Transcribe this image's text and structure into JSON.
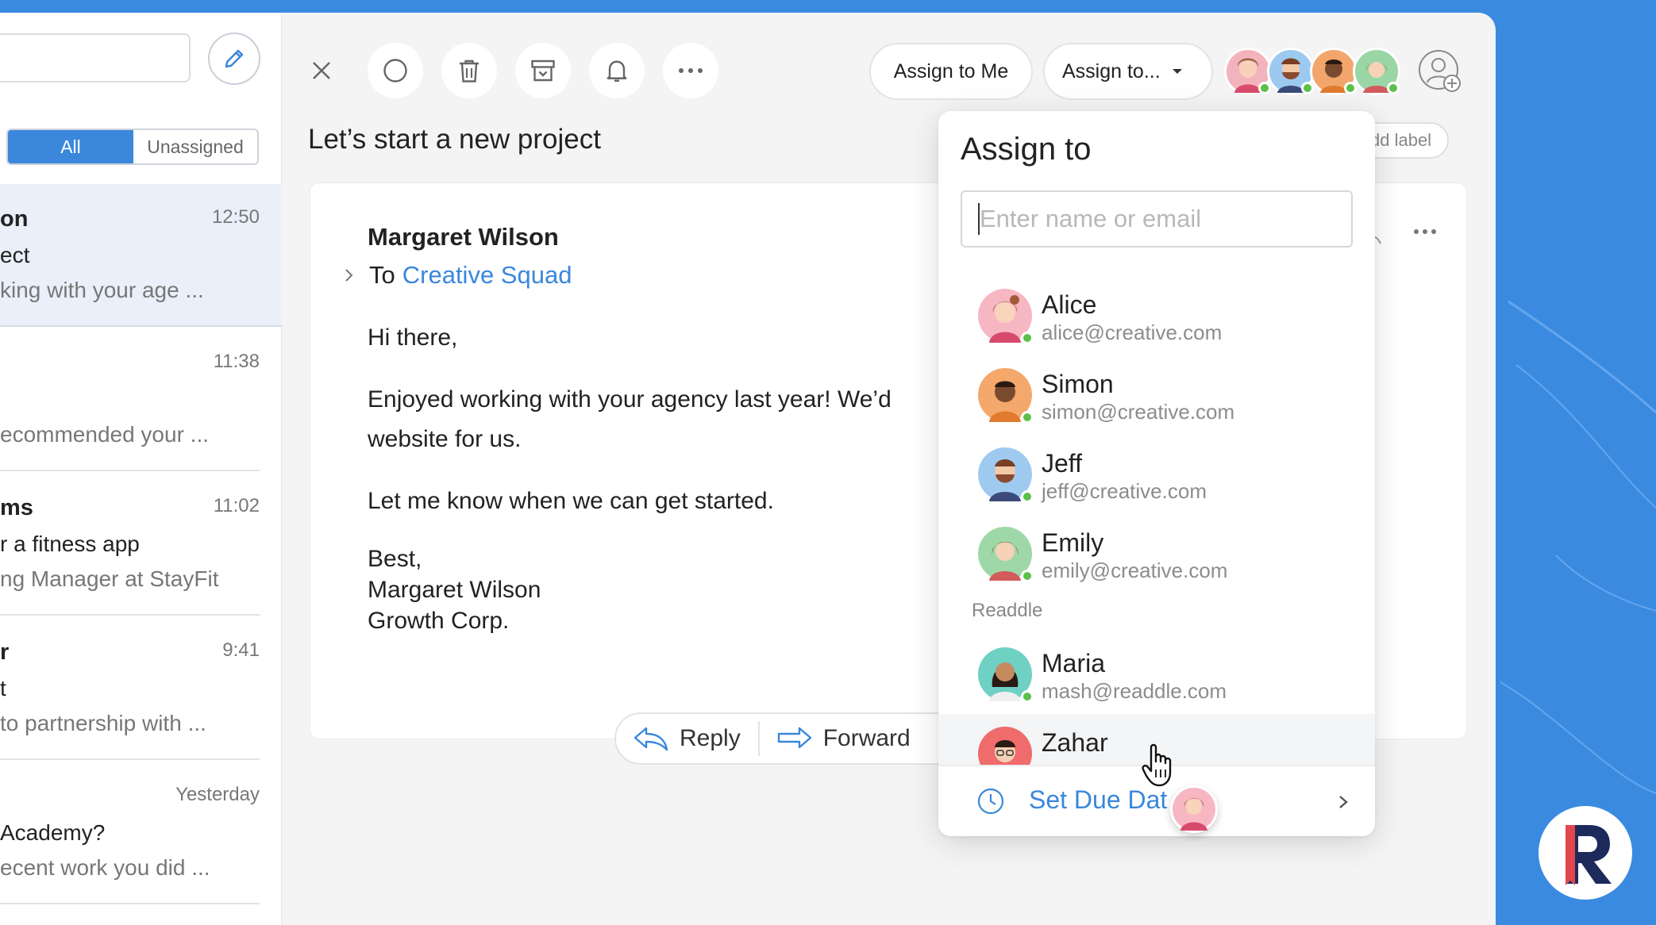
{
  "sidebar": {
    "filters": [
      "All",
      "Unassigned"
    ],
    "active_filter": "All",
    "items": [
      {
        "from": "on",
        "time": "12:50",
        "subject": "ect",
        "preview": "king with your age ...",
        "selected": true
      },
      {
        "from": "",
        "time": "11:38",
        "subject": "",
        "preview": "ecommended your ..."
      },
      {
        "from": "ms",
        "time": "11:02",
        "subject": "r a fitness app",
        "preview": "ng Manager at StayFit"
      },
      {
        "from": "r",
        "time": "9:41",
        "subject": "t",
        "preview": " to partnership with ..."
      },
      {
        "from": "",
        "time": "Yesterday",
        "subject": "Academy?",
        "preview": "ecent work you did ..."
      }
    ]
  },
  "toolbar": {
    "assign_to_me": "Assign to Me",
    "assign_to": "Assign to..."
  },
  "message": {
    "subject": "Let’s start a new project",
    "add_label": "dd label",
    "from": "Margaret Wilson",
    "to_prefix": "To",
    "to": "Creative Squad",
    "greeting": "Hi there,",
    "body_line1": "Enjoyed working with your agency last year! We’d",
    "body_line2": "website for us.",
    "body_line3": "Let me know when we can get started.",
    "sign_off": "Best,",
    "sign_name": "Margaret Wilson",
    "sign_company": "Growth Corp.",
    "reply": "Reply",
    "forward": "Forward"
  },
  "assign_popup": {
    "title": "Assign to",
    "placeholder": "Enter name or email",
    "people": [
      {
        "name": "Alice",
        "email": "alice@creative.com"
      },
      {
        "name": "Simon",
        "email": "simon@creative.com"
      },
      {
        "name": "Jeff",
        "email": "jeff@creative.com"
      },
      {
        "name": "Emily",
        "email": "emily@creative.com"
      }
    ],
    "group_label": "Readdle",
    "group_people": [
      {
        "name": "Maria",
        "email": "mash@readdle.com"
      },
      {
        "name": "Zahar",
        "email": ""
      }
    ],
    "due_date": "Set Due Dat"
  },
  "colors": {
    "accent": "#3a87dc",
    "online": "#5cbf4a",
    "background": "#3a8be0"
  },
  "icons": [
    "close-icon",
    "circle-icon",
    "trash-icon",
    "archive-icon",
    "bell-icon",
    "more-icon",
    "pencil-icon",
    "add-user-icon",
    "clock-icon",
    "chevron-right-icon",
    "reply-icon",
    "forward-icon",
    "hand-cursor-icon",
    "readdle-logo"
  ]
}
